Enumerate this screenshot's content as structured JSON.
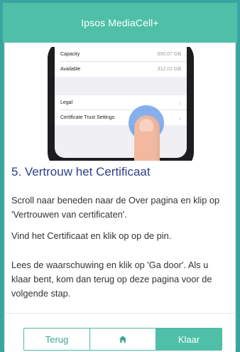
{
  "header": {
    "title": "Ipsos MediaCell+"
  },
  "illustration": {
    "rows": [
      {
        "label": "Capacity",
        "value": "500.07 GB"
      },
      {
        "label": "Available",
        "value": "312.01 GB"
      },
      {
        "label": "Legal",
        "value": ""
      },
      {
        "label": "Certificate Trust Settings",
        "value": ""
      }
    ]
  },
  "content": {
    "title": "5. Vertrouw het Certificaat",
    "paragraphs": [
      "Scroll naar beneden naar de Over pagina en klip op 'Vertrouwen van certificaten'.",
      "Vind het Certificaat en klik op op de pin.",
      "Lees de waarschuwing en klik op 'Ga door'. Als u klaar bent, kom dan terug op deze pagina voor de volgende stap."
    ]
  },
  "nav": {
    "back_label": "Terug",
    "home_icon": "home-icon",
    "done_label": "Klaar"
  },
  "colors": {
    "accent": "#4fbfa8",
    "title": "#2d3f86"
  }
}
